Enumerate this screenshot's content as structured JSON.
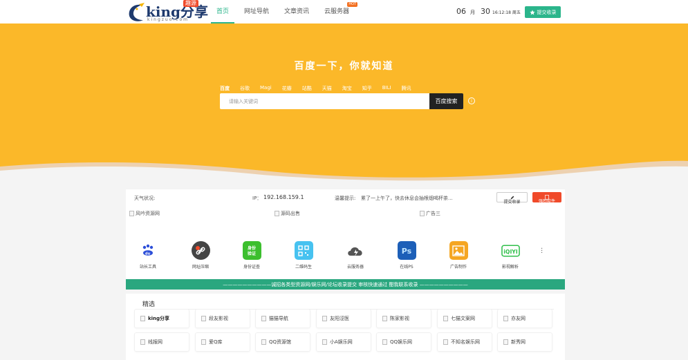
{
  "header": {
    "logo_text": "king分享",
    "logo_badge": "趣源",
    "logo_sub": "kingzuo.com",
    "nav": [
      {
        "label": "首页",
        "active": true
      },
      {
        "label": "网址导航"
      },
      {
        "label": "文章资讯"
      },
      {
        "label": "云服务器",
        "badge": "HOT"
      }
    ],
    "clock": {
      "month": "06",
      "month_unit": "月",
      "day": "30",
      "time_weekday": "16:12:18 周五"
    },
    "submit_label": "提交收录"
  },
  "hero": {
    "title": "百度一下，你就知道",
    "engines": [
      "百度",
      "谷歌",
      "Magi",
      "花瓣",
      "站酷",
      "天猫",
      "淘宝",
      "知乎",
      "BILI",
      "腾讯"
    ],
    "search_placeholder": "请输入关键词",
    "search_button": "百度搜索",
    "colors": {
      "bg": "#fbb829",
      "accent": "#2bb58b"
    }
  },
  "infobar": {
    "weather_label": "天气状况:",
    "ip_label": "IP：",
    "ip_value": "192.168.159.1",
    "tip_label": "温馨提示:",
    "tip_text": "累了一上午了，快去休息会抽根烟喝杯茶...",
    "submit_label": "提交收录",
    "download_label": "强烈软件"
  },
  "ads": [
    "风吟资源网",
    "源码出售",
    "广告三"
  ],
  "tools": [
    {
      "label": "站长工具",
      "icon": "baidu-du-icon"
    },
    {
      "label": "网址压缩",
      "icon": "link-icon"
    },
    {
      "label": "身份证查",
      "icon": "id-card-icon",
      "glyph": "身份\n验证"
    },
    {
      "label": "二维码生",
      "icon": "qrcode-icon"
    },
    {
      "label": "云服务器",
      "icon": "cloud-icon"
    },
    {
      "label": "在线PS",
      "icon": "photoshop-icon",
      "glyph": "Ps"
    },
    {
      "label": "广告制作",
      "icon": "image-icon"
    },
    {
      "label": "影视解析",
      "icon": "iqiyi-icon",
      "glyph": "iQIYI"
    }
  ],
  "banner": "——————————诚招各类型资源网/娱乐网/论坛收录提交 审核快速通过 酣我联系收录 ——————————",
  "selected": {
    "title": "精选",
    "row1": [
      "king分享",
      "段友影视",
      "猫猫导航",
      "友阳涩医",
      "陈家影视",
      "七猫文案网",
      "亦友网"
    ],
    "row2": [
      "线报网",
      "爱Q库",
      "QQ资源馆",
      "小A娱乐网",
      "QQ娱乐网",
      "不知名娱乐网",
      "新秀网"
    ]
  }
}
